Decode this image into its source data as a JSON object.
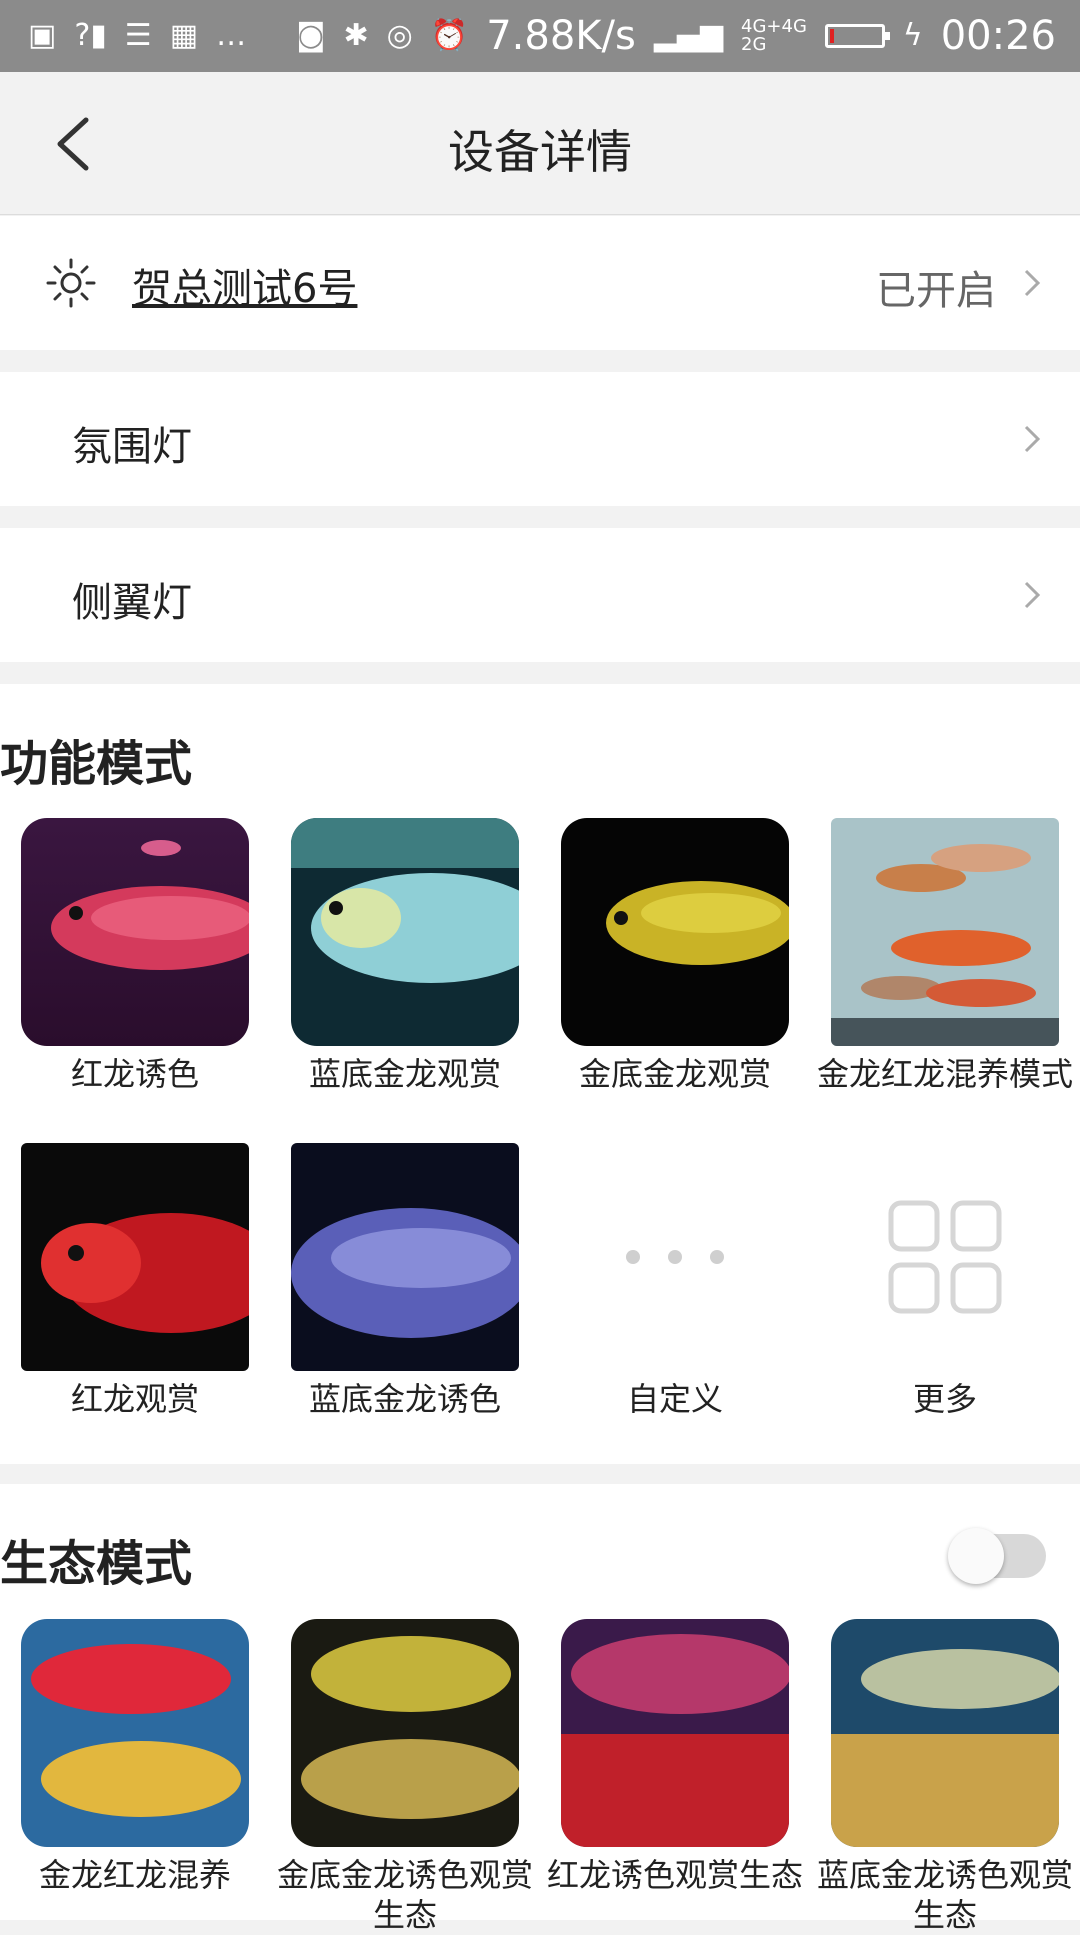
{
  "status_bar": {
    "speed": "7.88K/s",
    "time": "00:26"
  },
  "header": {
    "title": "设备详情"
  },
  "device": {
    "name": "贺总测试6号",
    "status": "已开启"
  },
  "rows": [
    {
      "label": "氛围灯"
    },
    {
      "label": "侧翼灯"
    }
  ],
  "function_mode": {
    "title": "功能模式",
    "items": [
      {
        "label": "红龙诱色"
      },
      {
        "label": "蓝底金龙观赏"
      },
      {
        "label": "金底金龙观赏"
      },
      {
        "label": "金龙红龙混养模式"
      },
      {
        "label": "红龙观赏"
      },
      {
        "label": "蓝底金龙诱色"
      },
      {
        "label": "自定义"
      },
      {
        "label": "更多"
      }
    ]
  },
  "eco_mode": {
    "title": "生态模式",
    "toggle_on": false,
    "items": [
      {
        "label": "金龙红龙混养"
      },
      {
        "label": "金底金龙诱色观赏生态"
      },
      {
        "label": "红龙诱色观赏生态"
      },
      {
        "label": "蓝底金龙诱色观赏生态"
      }
    ]
  },
  "colors": {
    "status_bar_bg": "#8b8b8b",
    "page_bg": "#f2f2f2",
    "card_bg": "#ffffff",
    "toggle_track": "#d8d8d8"
  }
}
